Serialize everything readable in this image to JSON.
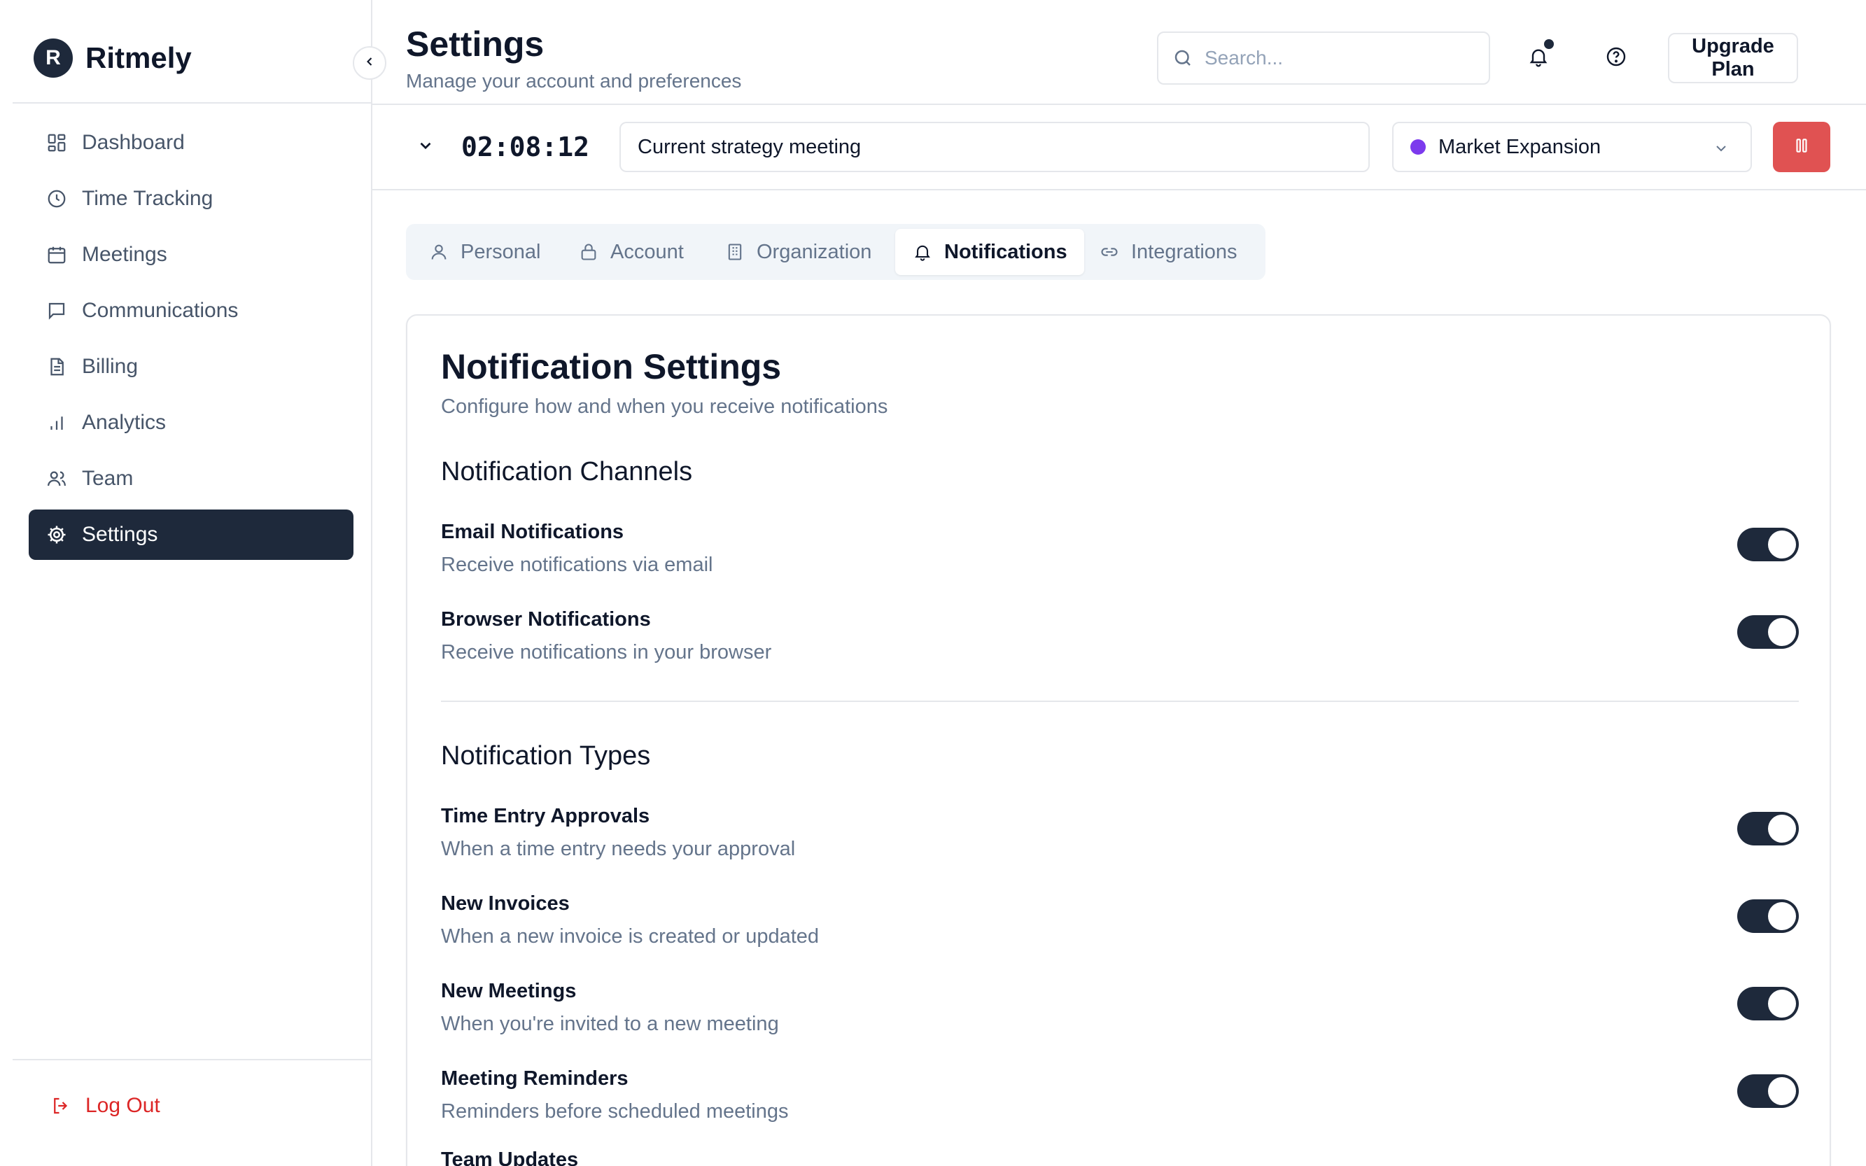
{
  "brand": {
    "logo_letter": "R",
    "name": "Ritmely"
  },
  "sidebar": {
    "items": [
      {
        "label": "Dashboard",
        "icon": "dashboard-icon",
        "active": false
      },
      {
        "label": "Time Tracking",
        "icon": "clock-icon",
        "active": false
      },
      {
        "label": "Meetings",
        "icon": "calendar-icon",
        "active": false
      },
      {
        "label": "Communications",
        "icon": "message-icon",
        "active": false
      },
      {
        "label": "Billing",
        "icon": "file-text-icon",
        "active": false
      },
      {
        "label": "Analytics",
        "icon": "bar-chart-icon",
        "active": false
      },
      {
        "label": "Team",
        "icon": "users-icon",
        "active": false
      },
      {
        "label": "Settings",
        "icon": "gear-icon",
        "active": true
      }
    ],
    "logout_label": "Log Out"
  },
  "header": {
    "title": "Settings",
    "subtitle": "Manage your account and preferences",
    "search_placeholder": "Search...",
    "upgrade_label": "Upgrade Plan"
  },
  "timer": {
    "time": "02:08:12",
    "description": "Current strategy meeting",
    "project": "Market Expansion",
    "project_color": "#7c3aed",
    "pause_color": "#e05252"
  },
  "tabs": [
    {
      "label": "Personal",
      "icon": "user-icon",
      "active": false
    },
    {
      "label": "Account",
      "icon": "lock-icon",
      "active": false
    },
    {
      "label": "Organization",
      "icon": "building-icon",
      "active": false
    },
    {
      "label": "Notifications",
      "icon": "bell-icon",
      "active": true
    },
    {
      "label": "Integrations",
      "icon": "link-icon",
      "active": false
    }
  ],
  "card": {
    "title": "Notification Settings",
    "subtitle": "Configure how and when you receive notifications",
    "channels_title": "Notification Channels",
    "channels": [
      {
        "label": "Email Notifications",
        "description": "Receive notifications via email",
        "enabled": true
      },
      {
        "label": "Browser Notifications",
        "description": "Receive notifications in your browser",
        "enabled": true
      }
    ],
    "types_title": "Notification Types",
    "types": [
      {
        "label": "Time Entry Approvals",
        "description": "When a time entry needs your approval",
        "enabled": true
      },
      {
        "label": "New Invoices",
        "description": "When a new invoice is created or updated",
        "enabled": true
      },
      {
        "label": "New Meetings",
        "description": "When you're invited to a new meeting",
        "enabled": true
      },
      {
        "label": "Meeting Reminders",
        "description": "Reminders before scheduled meetings",
        "enabled": true
      }
    ],
    "cut_off_label": "Team Updates"
  },
  "colors": {
    "primary": "#1e293b",
    "danger": "#dc2626",
    "border": "#e5e7eb",
    "muted": "#64748b"
  }
}
